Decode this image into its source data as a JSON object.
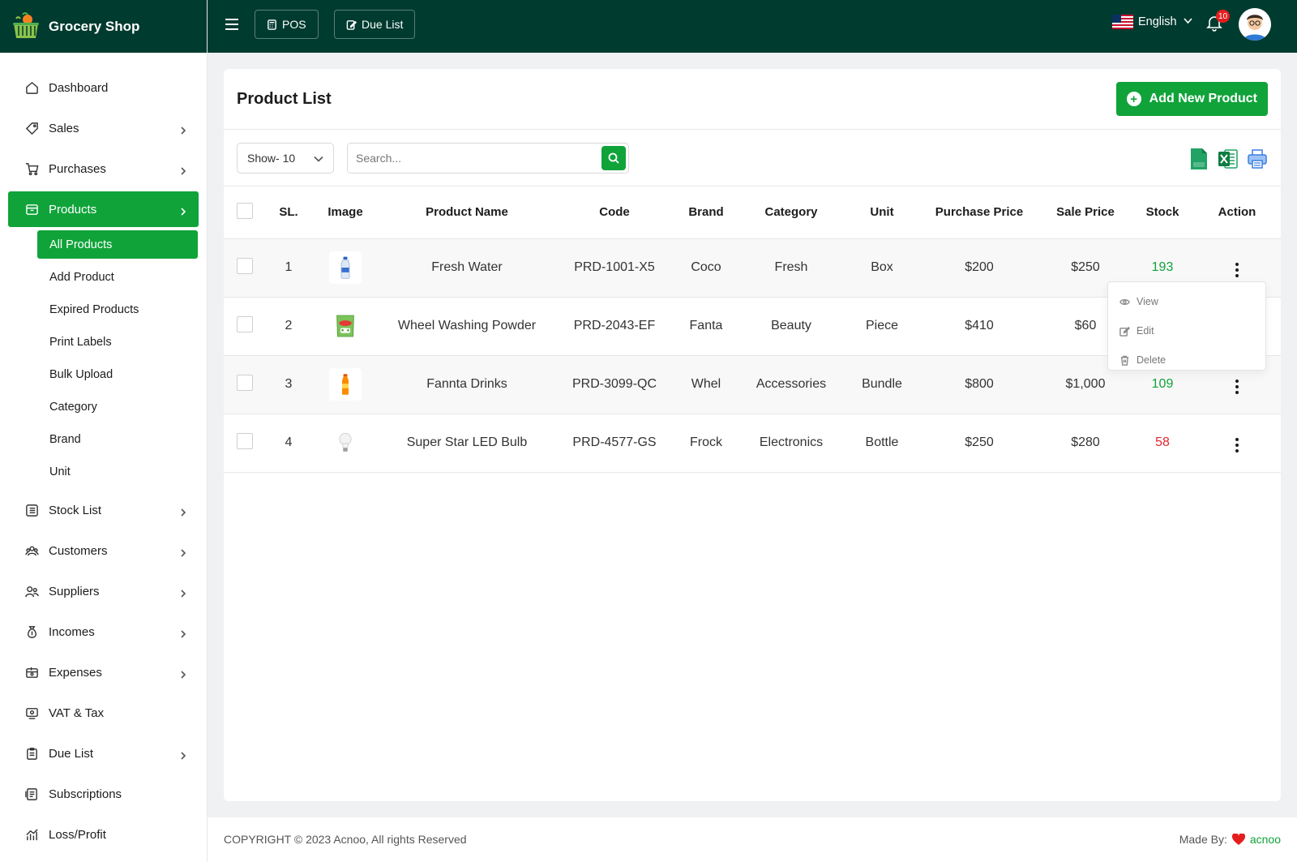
{
  "app": {
    "name": "Grocery Shop"
  },
  "topbar": {
    "pos_label": "POS",
    "due_list_label": "Due List",
    "language": "English",
    "notification_count": "10"
  },
  "sidebar": {
    "items": [
      {
        "label": "Dashboard",
        "icon": "dashboard-icon",
        "has_chevron": false
      },
      {
        "label": "Sales",
        "icon": "tag-icon",
        "has_chevron": true
      },
      {
        "label": "Purchases",
        "icon": "cart-icon",
        "has_chevron": true
      },
      {
        "label": "Products",
        "icon": "box-icon",
        "has_chevron": true,
        "active": true
      },
      {
        "label": "Stock List",
        "icon": "list-icon",
        "has_chevron": true
      },
      {
        "label": "Customers",
        "icon": "customers-icon",
        "has_chevron": true
      },
      {
        "label": "Suppliers",
        "icon": "suppliers-icon",
        "has_chevron": true
      },
      {
        "label": "Incomes",
        "icon": "money-bag-icon",
        "has_chevron": true
      },
      {
        "label": "Expenses",
        "icon": "wallet-icon",
        "has_chevron": true
      },
      {
        "label": "VAT & Tax",
        "icon": "receipt-icon",
        "has_chevron": false
      },
      {
        "label": "Due List",
        "icon": "clipboard-icon",
        "has_chevron": true
      },
      {
        "label": "Subscriptions",
        "icon": "subscription-icon",
        "has_chevron": false
      },
      {
        "label": "Loss/Profit",
        "icon": "chart-icon",
        "has_chevron": false
      }
    ],
    "products_submenu": [
      {
        "label": "All Products",
        "active": true
      },
      {
        "label": "Add Product"
      },
      {
        "label": "Expired Products"
      },
      {
        "label": "Print Labels"
      },
      {
        "label": "Bulk Upload"
      },
      {
        "label": "Category"
      },
      {
        "label": "Brand"
      },
      {
        "label": "Unit"
      }
    ]
  },
  "main": {
    "title": "Product List",
    "add_button_label": "Add New Product",
    "show_select_value": "Show- 10",
    "search_placeholder": "Search...",
    "export_icons": [
      "csv-icon",
      "excel-icon",
      "print-icon"
    ],
    "table": {
      "headers": [
        "SL.",
        "Image",
        "Product Name",
        "Code",
        "Brand",
        "Category",
        "Unit",
        "Purchase Price",
        "Sale Price",
        "Stock",
        "Action"
      ],
      "rows": [
        {
          "sl": "1",
          "name": "Fresh Water",
          "code": "PRD-1001-X5",
          "brand": "Coco",
          "category": "Fresh",
          "unit": "Box",
          "purchase_price": "$200",
          "sale_price": "$250",
          "stock": "193",
          "stock_status": "ok",
          "image_icon": "water-bottle-icon"
        },
        {
          "sl": "2",
          "name": "Wheel Washing Powder",
          "code": "PRD-2043-EF",
          "brand": "Fanta",
          "category": "Beauty",
          "unit": "Piece",
          "purchase_price": "$410",
          "sale_price": "$60",
          "stock": "",
          "stock_status": "ok",
          "image_icon": "detergent-pack-icon"
        },
        {
          "sl": "3",
          "name": "Fannta Drinks",
          "code": "PRD-3099-QC",
          "brand": "Whel",
          "category": "Accessories",
          "unit": "Bundle",
          "purchase_price": "$800",
          "sale_price": "$1,000",
          "stock": "109",
          "stock_status": "ok",
          "image_icon": "drink-bottle-icon"
        },
        {
          "sl": "4",
          "name": "Super Star LED Bulb",
          "code": "PRD-4577-GS",
          "brand": "Frock",
          "category": "Electronics",
          "unit": "Bottle",
          "purchase_price": "$250",
          "sale_price": "$280",
          "stock": "58",
          "stock_status": "low",
          "image_icon": "bulb-icon"
        }
      ]
    },
    "action_menu": {
      "view": "View",
      "edit": "Edit",
      "delete": "Delete"
    }
  },
  "footer": {
    "copyright": "COPYRIGHT © 2023 Acnoo, All rights Reserved",
    "made_by_label": "Made By:",
    "made_by_brand": "acnoo"
  },
  "colors": {
    "primary_green": "#10a33a",
    "dark_header": "#003b2f",
    "danger_red": "#e5262e"
  }
}
